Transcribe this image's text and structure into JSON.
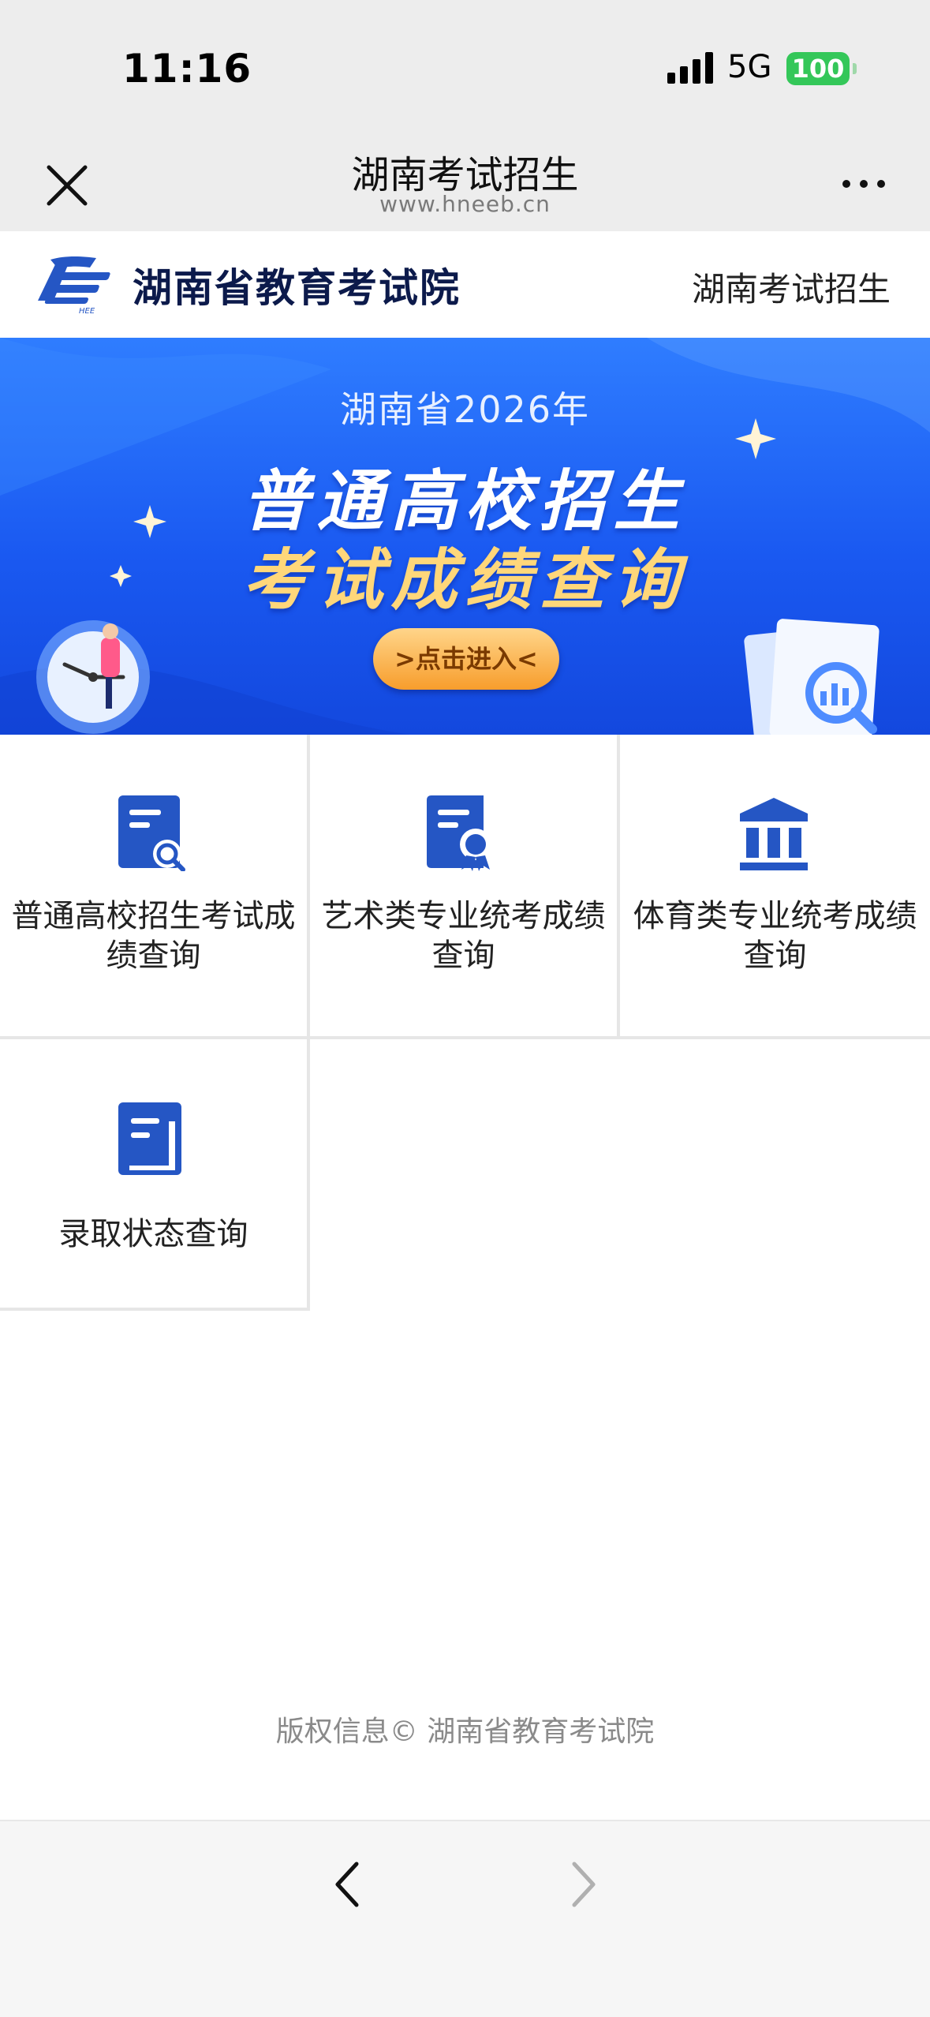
{
  "status_bar": {
    "time": "11:16",
    "network": "5G",
    "battery": "100"
  },
  "nav_bar": {
    "title": "湖南考试招生",
    "url": "www.hneeb.cn"
  },
  "header": {
    "site_name": "湖南省教育考试院",
    "site_link": "湖南考试招生"
  },
  "banner": {
    "subtitle": "湖南省2026年",
    "title_line1": "普通高校招生",
    "title_line2": "考试成绩查询",
    "button": ">点击进入<"
  },
  "services": [
    {
      "label": "普通高校招生考试成绩查询",
      "icon": "document-search-icon"
    },
    {
      "label": "艺术类专业统考成绩查询",
      "icon": "certificate-icon"
    },
    {
      "label": "体育类专业统考成绩查询",
      "icon": "institution-icon"
    },
    {
      "label": "录取状态查询",
      "icon": "book-icon"
    }
  ],
  "footer": {
    "copyright": "版权信息© 湖南省教育考试院"
  },
  "colors": {
    "primary_blue": "#2556c4",
    "banner_blue": "#1a59f1",
    "banner_button": "#f79d2c",
    "battery_green": "#34c759"
  }
}
